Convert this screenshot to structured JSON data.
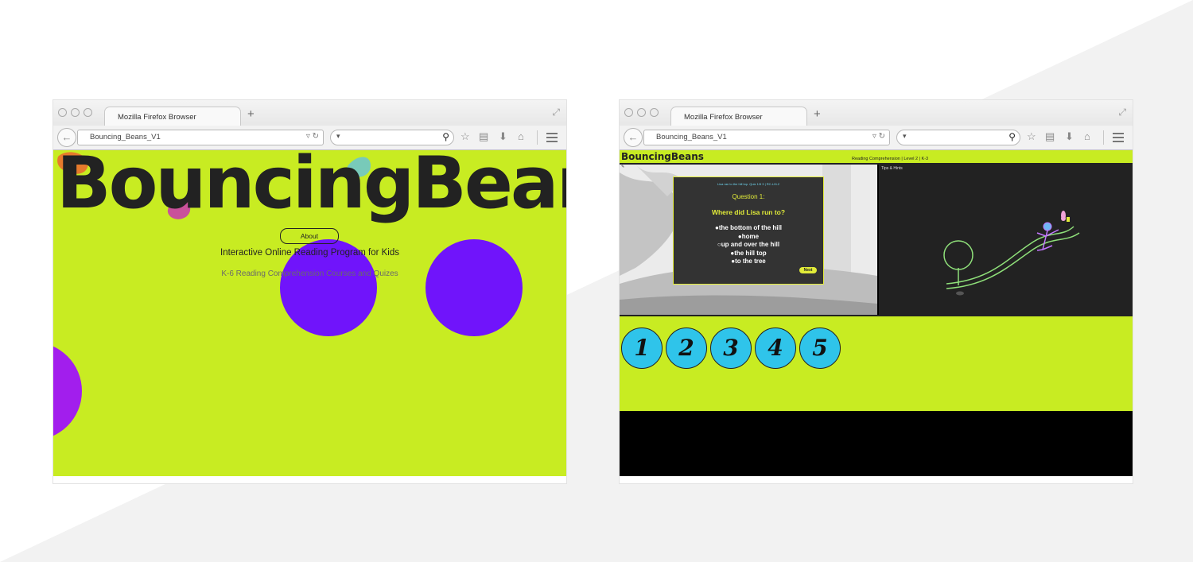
{
  "colors": {
    "lime": "#c8ec22",
    "purple": "#7014fb",
    "magenta": "#a21eed",
    "number_blue": "#2fc4ea",
    "quiz_panel": "#333333",
    "quiz_yellow": "#e2ec39",
    "dark_panel": "#222222",
    "orange_blob": "#e67a2c",
    "pink_blob": "#c9519a",
    "teal_blob": "#78cab9"
  },
  "window_left": {
    "tab_title": "Mozilla Firefox Browser",
    "url": "Bouncing_Beans_V1",
    "logo_text": "BouncingBeans",
    "about_button": "About",
    "headline": "Interactive Online Reading Program for Kids",
    "subheadline": "K-6 Reading Comprehension Courses and Quizes"
  },
  "window_right": {
    "tab_title": "Mozilla Firefox Browser",
    "url": "Bouncing_Beans_V1",
    "logo_text": "BouncingBeans",
    "breadcrumb": "Reading Comprehension | Level 2 | K-3",
    "tips_label": "Tips & Hints",
    "quiz": {
      "small_header": "Lisa ran to the hill top. Quiz 1/5 3 | RC-LVL2",
      "question_label": "Question 1:",
      "question_text": "Where did Lisa run to?",
      "options": [
        "the bottom of the hill",
        "home",
        "up and over the hill",
        "the hill top",
        "to the tree"
      ],
      "next_button": "Next"
    },
    "numbers": [
      "1",
      "2",
      "3",
      "4",
      "5"
    ]
  },
  "icons": [
    "back-arrow-icon",
    "reload-icon",
    "search-icon",
    "star-icon",
    "clipboard-icon",
    "download-icon",
    "home-icon",
    "hamburger-menu-icon",
    "resize-icon",
    "new-tab-icon"
  ]
}
